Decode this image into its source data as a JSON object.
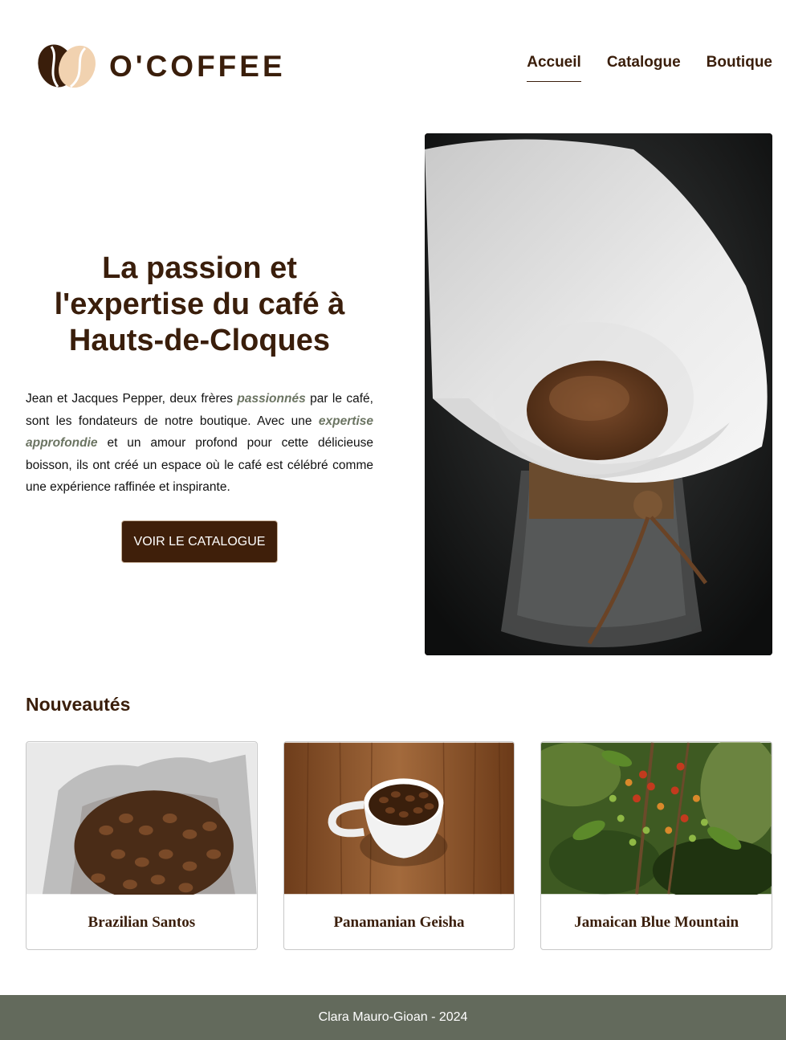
{
  "brand": {
    "name": "O'COFFEE",
    "colors": {
      "primary": "#3a1e0b",
      "accent": "#6b7462",
      "footer": "#636a5c",
      "bean_light": "#f1d2b0"
    }
  },
  "nav": {
    "items": [
      {
        "label": "Accueil",
        "active": true
      },
      {
        "label": "Catalogue",
        "active": false
      },
      {
        "label": "Boutique",
        "active": false
      }
    ]
  },
  "hero": {
    "title": "La passion et l'expertise du café à Hauts-de-Cloques",
    "desc_parts": [
      "Jean et Jacques Pepper, deux frères ",
      "passionnés",
      " par le café, sont les fondateurs de notre boutique. Avec une ",
      "expertise approfondie",
      " et un amour profond pour cette délicieuse boisson, ils ont créé un espace où le café est célébré comme une expérience raffinée et inspirante."
    ],
    "cta_label": "VOIR LE CATALOGUE",
    "image_icon": "coffee-filter-photo"
  },
  "news": {
    "title": "Nouveautés",
    "cards": [
      {
        "title": "Brazilian Santos",
        "image_icon": "coffee-bag-photo"
      },
      {
        "title": "Panamanian Geisha",
        "image_icon": "coffee-cup-photo"
      },
      {
        "title": "Jamaican Blue Mountain",
        "image_icon": "coffee-plant-photo"
      }
    ]
  },
  "footer": {
    "text": "Clara Mauro-Gioan - 2024"
  }
}
